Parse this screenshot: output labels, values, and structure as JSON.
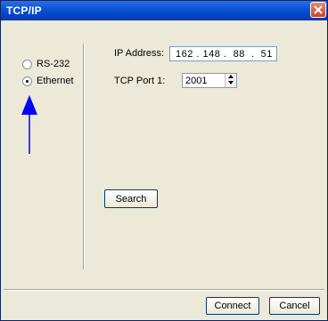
{
  "window": {
    "title": "TCP/IP"
  },
  "connection": {
    "options": [
      {
        "label": "RS-232",
        "selected": false
      },
      {
        "label": "Ethernet",
        "selected": true
      }
    ]
  },
  "form": {
    "ip_label": "IP Address:",
    "ip_value": "162 . 148 .  88  .  51",
    "port_label": "TCP Port 1:",
    "port_value": "2001"
  },
  "buttons": {
    "search": "Search",
    "connect": "Connect",
    "cancel": "Cancel"
  },
  "colors": {
    "annotation_arrow": "#0000ff",
    "title_bar": "#0046c8"
  }
}
